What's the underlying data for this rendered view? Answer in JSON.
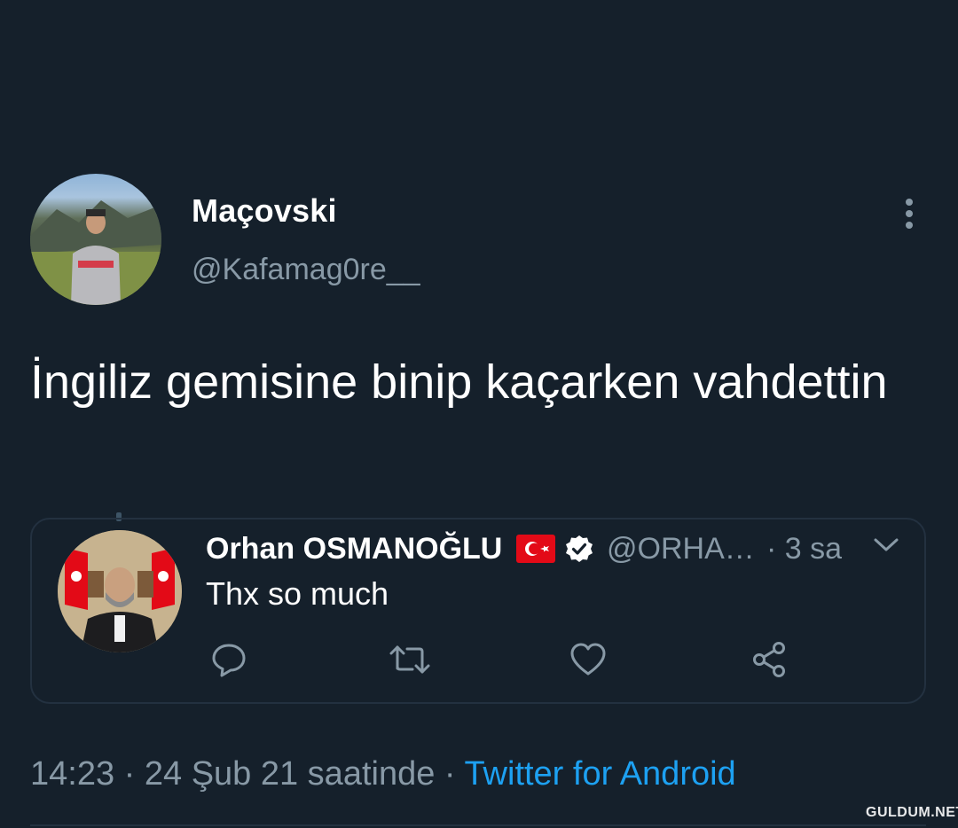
{
  "tweet": {
    "display_name": "Maçovski",
    "handle": "@Kafamag0re__",
    "text": "İngiliz gemisine binip kaçarken vahdettin",
    "timestamp": "14:23 · 24 Şub 21 saatinde · ",
    "source": "Twitter for Android",
    "more_icon": "more-vertical-icon"
  },
  "quoted_tweet": {
    "display_name": "Orhan OSMANOĞLU",
    "handle": "@ORHA…",
    "time": "· 3 sa",
    "text": "Thx so much",
    "badges": [
      "turkey-flag-icon",
      "verified-badge-icon"
    ],
    "actions": [
      "reply-icon",
      "retweet-icon",
      "like-icon",
      "share-icon"
    ]
  },
  "watermark": "GULDUM.NET",
  "colors": {
    "background": "#15202b",
    "text_primary": "#ffffff",
    "text_secondary": "#8899a6",
    "accent": "#1da1f2",
    "border": "#233140"
  }
}
